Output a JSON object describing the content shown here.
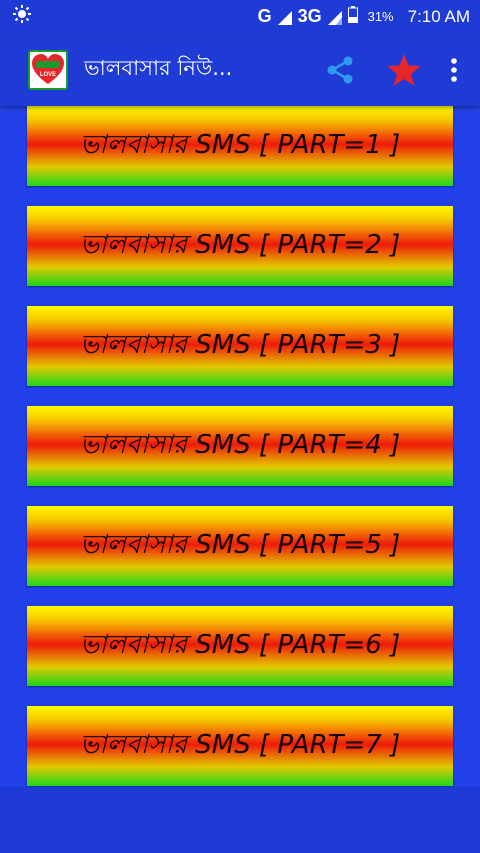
{
  "status_bar": {
    "network_g": "G",
    "network_3g": "3G",
    "battery_percent": "31%",
    "time": "7:10 AM"
  },
  "app_bar": {
    "title": "ভালবাসার নিউ...",
    "logo_text": "LOVE",
    "actions": [
      "share-icon",
      "star-icon",
      "more-vert-icon"
    ]
  },
  "list": {
    "items": [
      {
        "label": "ভালবাসার SMS [ PART=1 ]"
      },
      {
        "label": "ভালবাসার SMS [ PART=2 ]"
      },
      {
        "label": "ভালবাসার SMS [ PART=3 ]"
      },
      {
        "label": "ভালবাসার SMS [ PART=4 ]"
      },
      {
        "label": "ভালবাসার SMS [ PART=5 ]"
      },
      {
        "label": "ভালবাসার SMS [ PART=6 ]"
      },
      {
        "label": "ভালবাসার SMS [ PART=7 ]"
      }
    ]
  },
  "colors": {
    "app_bar": "#1e3bd6",
    "list_background": "#2241e8",
    "share_icon": "#2f9bf0",
    "star_icon": "#e8262a",
    "button_top": "#fffc00",
    "button_middle": "#ee1a0a",
    "button_bottom": "#1dd51d"
  }
}
